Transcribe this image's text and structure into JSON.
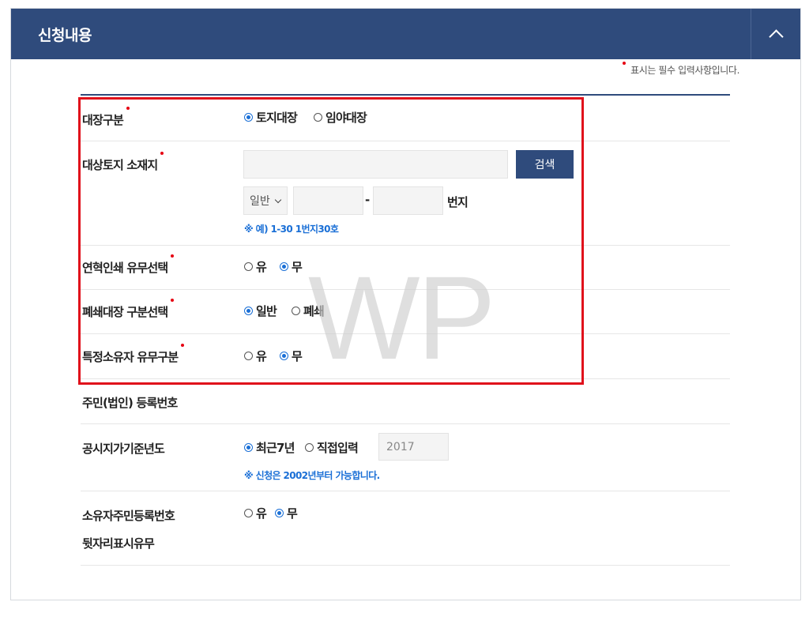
{
  "header": {
    "title": "신청내용",
    "toggle_icon": "chevron-up-icon"
  },
  "required_note": "표시는 필수 입력사항입니다.",
  "rows": {
    "ledger_type": {
      "label": "대장구분",
      "options": [
        {
          "label": "토지대장",
          "selected": true
        },
        {
          "label": "임야대장",
          "selected": false
        }
      ]
    },
    "location": {
      "label": "대상토지 소재지",
      "address_value": "",
      "search_label": "검색",
      "select_value": "일반",
      "lot_main_value": "",
      "lot_sub_value": "",
      "dash": "-",
      "unit_label": "번지",
      "hint": "※ 예) 1-30 1번지30호"
    },
    "history_print": {
      "label": "연혁인쇄 유무선택",
      "options": [
        {
          "label": "유",
          "selected": false
        },
        {
          "label": "무",
          "selected": true
        }
      ]
    },
    "closed_ledger": {
      "label": "폐쇄대장 구분선택",
      "options": [
        {
          "label": "일반",
          "selected": true
        },
        {
          "label": "폐쇄",
          "selected": false
        }
      ]
    },
    "specific_owner": {
      "label": "특정소유자 유무구분",
      "options": [
        {
          "label": "유",
          "selected": false
        },
        {
          "label": "무",
          "selected": true
        }
      ]
    },
    "resident_number": {
      "label": "주민(법인) 등록번호"
    },
    "base_year": {
      "label": "공시지가기준년도",
      "options": [
        {
          "label": "최근7년",
          "selected": true
        },
        {
          "label": "직접입력",
          "selected": false
        }
      ],
      "year_value": "2017",
      "hint": "※ 신청은 2002년부터 가능합니다."
    },
    "owner_rrn_suffix": {
      "label_line1": "소유자주민등록번호",
      "label_line2": "뒷자리표시유무",
      "options": [
        {
          "label": "유",
          "selected": false
        },
        {
          "label": "무",
          "selected": true
        }
      ]
    }
  },
  "watermark": "WP",
  "colors": {
    "header": "#2f4b7c",
    "accent": "#1a6fd6",
    "required": "#e60012",
    "highlight": "#e0101b"
  }
}
